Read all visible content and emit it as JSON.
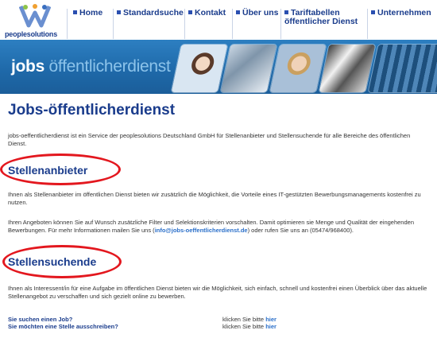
{
  "logo": {
    "text": "peoplesolutions"
  },
  "nav": [
    {
      "label": "Home"
    },
    {
      "label": "Standardsuche"
    },
    {
      "label": "Kontakt"
    },
    {
      "label": "Über uns"
    },
    {
      "label": "Tariftabellen öffentlicher Dienst"
    },
    {
      "label": "Unternehmen"
    }
  ],
  "banner": {
    "title_bold": "jobs",
    "title_light": "öffentlicherdienst"
  },
  "main": {
    "title": "Jobs-öffentlicherdienst",
    "intro": "jobs-oeffentlicherdienst ist ein Service der peoplesolutions Deutschland GmbH für Stellenanbieter und Stellensuchende für alle Bereiche des öffentlichen Dienst.",
    "sec1": {
      "heading": "Stellenanbieter",
      "p1": "Ihnen als Stellenanbieter im öffentlichen Dienst bieten wir zusätzlich die Möglichkeit, die Vorteile eines IT-gestützten Bewerbungsmanagements kostenfrei zu nutzen.",
      "p2_start": "Ihren Angeboten können Sie auf Wunsch zusätzliche Filter und Selektionskriterien vorschalten. Damit optimieren sie Menge und Qualität der eingehenden Bewerbungen. Für mehr Informationen mailen Sie uns (",
      "email": "info@jobs-oeffentlicherdienst.de",
      "p2_end": ") oder rufen Sie uns an (05474/968400)."
    },
    "sec2": {
      "heading": "Stellensuchende",
      "p1": "Ihnen als Interessent/in für eine Aufgabe im öffentlichen Dienst bieten wir die Möglichkeit, sich einfach, schnell und kostenfrei einen Überblick über das aktuelle Stellenangebot zu verschaffen und sich gezielt online zu bewerben."
    },
    "qa": [
      {
        "question": "Sie suchen einen Job?",
        "answer": "klicken Sie bitte",
        "link": "hier"
      },
      {
        "question": "Sie möchten eine Stelle ausschreiben?",
        "answer": "klicken Sie bitte",
        "link": "hier"
      }
    ]
  }
}
